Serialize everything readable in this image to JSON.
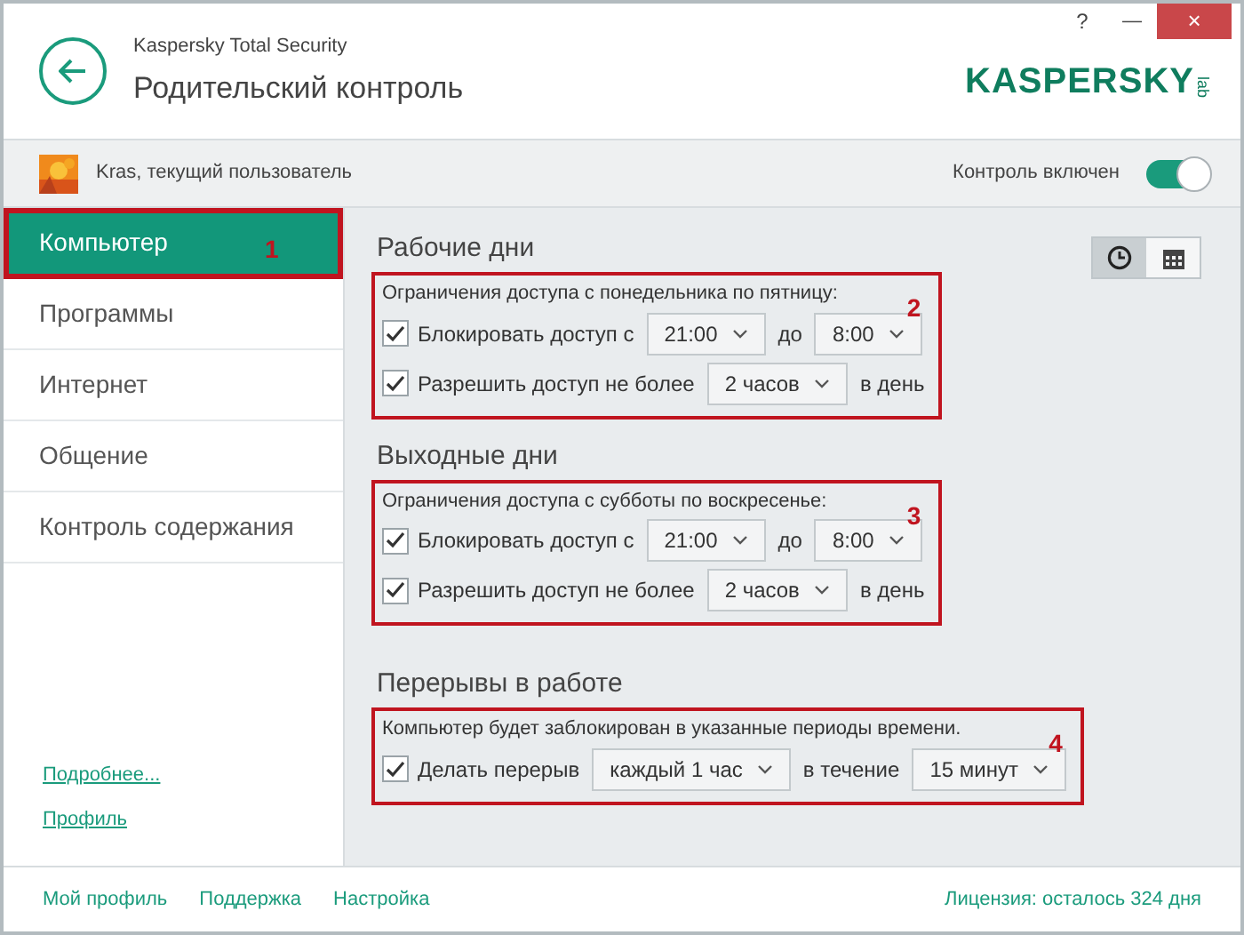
{
  "window": {
    "controls": [
      {
        "kind": "help",
        "text": "?"
      },
      {
        "kind": "minimize",
        "text": "—"
      },
      {
        "kind": "close",
        "text": "×"
      }
    ]
  },
  "header": {
    "product": "Kaspersky Total Security",
    "title": "Родительский контроль",
    "logo": {
      "name": "KASPERSKY",
      "suffix": "lab"
    }
  },
  "user_bar": {
    "user": "Kras, текущий пользователь",
    "control_label": "Контроль включен",
    "control_on": true
  },
  "sidebar": {
    "items": [
      {
        "label": "Компьютер",
        "selected": true,
        "marker": "1"
      },
      {
        "label": "Программы",
        "selected": false
      },
      {
        "label": "Интернет",
        "selected": false
      },
      {
        "label": "Общение",
        "selected": false
      },
      {
        "label": "Контроль содержания",
        "selected": false
      }
    ],
    "links": [
      "Подробнее...",
      "Профиль"
    ]
  },
  "view_switch": [
    {
      "kind": "clock",
      "selected": true
    },
    {
      "kind": "calendar",
      "selected": false
    }
  ],
  "sections": [
    {
      "title": "Рабочие дни",
      "marker": "2",
      "note": "Ограничения доступа с понедельника по пятницу:",
      "rows": [
        {
          "checked": true,
          "label": "Блокировать доступ с",
          "items": [
            {
              "kind": "dropdown",
              "value": "21:00"
            },
            {
              "kind": "text",
              "text": "до"
            },
            {
              "kind": "dropdown",
              "value": "8:00"
            }
          ]
        },
        {
          "checked": true,
          "label": "Разрешить доступ не более",
          "items": [
            {
              "kind": "dropdown",
              "value": "2 часов"
            },
            {
              "kind": "text",
              "text": "в день"
            }
          ]
        }
      ]
    },
    {
      "title": "Выходные дни",
      "marker": "3",
      "note": "Ограничения доступа с субботы по воскресенье:",
      "rows": [
        {
          "checked": true,
          "label": "Блокировать доступ с",
          "items": [
            {
              "kind": "dropdown",
              "value": "21:00"
            },
            {
              "kind": "text",
              "text": "до"
            },
            {
              "kind": "dropdown",
              "value": "8:00"
            }
          ]
        },
        {
          "checked": true,
          "label": "Разрешить доступ не более",
          "items": [
            {
              "kind": "dropdown",
              "value": "2 часов"
            },
            {
              "kind": "text",
              "text": "в день"
            }
          ]
        }
      ]
    },
    {
      "title": "Перерывы в работе",
      "marker": "4",
      "note": "Компьютер будет заблокирован в указанные периоды времени.",
      "rows": [
        {
          "checked": true,
          "label": "Делать перерыв",
          "items": [
            {
              "kind": "dropdown",
              "value": "каждый 1 час"
            },
            {
              "kind": "text",
              "text": "в течение"
            },
            {
              "kind": "dropdown",
              "value": "15 минут"
            }
          ]
        }
      ]
    }
  ],
  "footer": {
    "links": [
      "Мой профиль",
      "Поддержка",
      "Настройка"
    ],
    "license": "Лицензия: осталось 324 дня"
  }
}
